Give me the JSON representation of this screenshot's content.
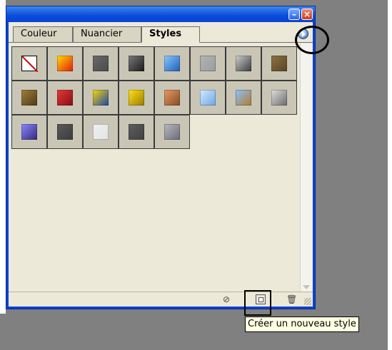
{
  "tabs": [
    {
      "label": "Couleur"
    },
    {
      "label": "Nuancier"
    },
    {
      "label": "Styles",
      "active": true
    }
  ],
  "window_buttons": {
    "minimize_icon": "minimize-icon",
    "close_icon": "close-icon"
  },
  "styles": [
    {
      "name": "none",
      "colors": [
        "#ffffff",
        "#ffffff"
      ],
      "slash": true
    },
    {
      "name": "red-glow",
      "colors": [
        "#ffdd00",
        "#e31b0d"
      ]
    },
    {
      "name": "grey-frame",
      "colors": [
        "#6a6a6a",
        "#4a4a4a"
      ]
    },
    {
      "name": "dark-bevel",
      "colors": [
        "#7a7a7a",
        "#1a1a1a"
      ]
    },
    {
      "name": "blue-glass",
      "colors": [
        "#8ec6ff",
        "#1c5fb6"
      ]
    },
    {
      "name": "grey-flat",
      "colors": [
        "#b4b4b4",
        "#9c9c9c"
      ]
    },
    {
      "name": "grey-gradient",
      "colors": [
        "#cfcfcf",
        "#3a3a3a"
      ]
    },
    {
      "name": "brown",
      "colors": [
        "#8a7244",
        "#5c4524"
      ]
    },
    {
      "name": "brown-bevel",
      "colors": [
        "#a17f3c",
        "#4f3a14"
      ]
    },
    {
      "name": "red-stripes",
      "colors": [
        "#e23a3a",
        "#8a0c12"
      ]
    },
    {
      "name": "multicolor",
      "colors": [
        "#f4d80b",
        "#1c43a8"
      ]
    },
    {
      "name": "yellow-gold",
      "colors": [
        "#ffe21a",
        "#9c7b00"
      ]
    },
    {
      "name": "copper",
      "colors": [
        "#e59a64",
        "#8a4a22"
      ]
    },
    {
      "name": "light-blue",
      "colors": [
        "#d4ebff",
        "#6aa6e2"
      ]
    },
    {
      "name": "landscape",
      "colors": [
        "#8ac4ff",
        "#b27a2c"
      ]
    },
    {
      "name": "texture",
      "colors": [
        "#e0e0e0",
        "#6a6a6a"
      ]
    },
    {
      "name": "purple",
      "colors": [
        "#8a8aff",
        "#34287a"
      ]
    },
    {
      "name": "dark-grey",
      "colors": [
        "#5a5a5a",
        "#3c3c3c"
      ]
    },
    {
      "name": "outline",
      "colors": [
        "#f0f0f0",
        "#e4e4e4"
      ]
    },
    {
      "name": "charcoal",
      "colors": [
        "#5e5e5e",
        "#404040"
      ]
    },
    {
      "name": "steel",
      "colors": [
        "#b8b8c2",
        "#6c6c78"
      ]
    }
  ],
  "bottom_bar": {
    "no_entry_icon": "no-entry-icon",
    "new_style_icon": "new-style-icon",
    "trash_icon": "trash-icon"
  },
  "tooltip": {
    "text": "Créer un nouveau style"
  }
}
